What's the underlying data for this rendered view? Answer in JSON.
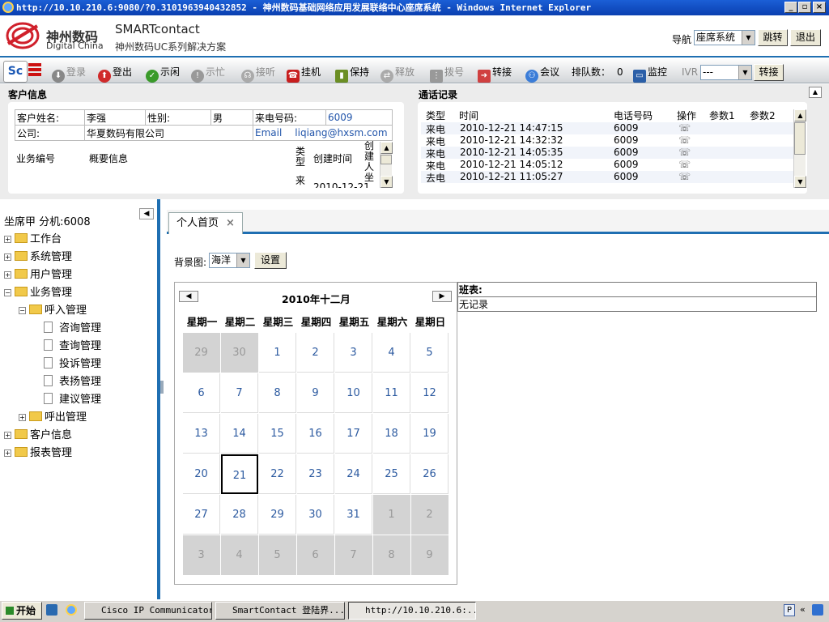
{
  "window": {
    "title": "http://10.10.210.6:9080/?0.3101963940432852 - 神州数码基础网络应用发展联络中心座席系统 - Windows Internet Explorer"
  },
  "header": {
    "logo_cn": "神州数码",
    "logo_en": "Digital China",
    "product": "SMARTcontact",
    "product_sub": "神州数码UC系列解决方案",
    "nav_label": "导航",
    "nav_select": "座席系统",
    "jump_label": "跳转",
    "exit_label": "退出"
  },
  "toolbar": {
    "login": "登录",
    "logout": "登出",
    "idle": "示闲",
    "busy": "示忙",
    "answer": "接听",
    "hangup": "挂机",
    "hold": "保持",
    "release": "释放",
    "dial": "拨号",
    "transfer": "转接",
    "conference": "会议",
    "queue_label": "排队数：",
    "queue_count": "0",
    "monitor": "监控",
    "ivr_label": "IVR",
    "ivr_select": "---",
    "ivr_transfer": "转接"
  },
  "customer": {
    "title": "客户信息",
    "name_label": "客户姓名:",
    "name": "李强",
    "gender_label": "性别:",
    "gender": "男",
    "phone_label": "来电号码:",
    "phone": "6009",
    "company_label": "公司:",
    "company": "华夏数码有限公司",
    "email_label": "Email",
    "email": "liqiang@hxsm.com",
    "biz_no": "业务编号",
    "summary": "概要信息",
    "col_type": "类型",
    "col_created": "创建时间",
    "col_creator": "创建人坐",
    "row_type": "来",
    "row_created": "2010-12-21"
  },
  "calllog": {
    "title": "通话记录",
    "headers": [
      "类型",
      "时间",
      "电话号码",
      "操作",
      "参数1",
      "参数2"
    ],
    "rows": [
      {
        "type": "来电",
        "time": "2010-12-21 14:47:15",
        "phone": "6009"
      },
      {
        "type": "来电",
        "time": "2010-12-21 14:32:32",
        "phone": "6009"
      },
      {
        "type": "来电",
        "time": "2010-12-21 14:05:35",
        "phone": "6009"
      },
      {
        "type": "来电",
        "time": "2010-12-21 14:05:12",
        "phone": "6009"
      },
      {
        "type": "去电",
        "time": "2010-12-21 11:05:27",
        "phone": "6009"
      }
    ]
  },
  "agent": {
    "label": "坐席甲 分机:6008"
  },
  "tree": [
    {
      "label": "工作台",
      "kind": "folder",
      "level": 0,
      "expanded": false
    },
    {
      "label": "系统管理",
      "kind": "folder",
      "level": 0,
      "expanded": false
    },
    {
      "label": "用户管理",
      "kind": "folder",
      "level": 0,
      "expanded": false
    },
    {
      "label": "业务管理",
      "kind": "folder",
      "level": 0,
      "expanded": true
    },
    {
      "label": "呼入管理",
      "kind": "folder",
      "level": 1,
      "expanded": true
    },
    {
      "label": "咨询管理",
      "kind": "doc",
      "level": 2
    },
    {
      "label": "查询管理",
      "kind": "doc",
      "level": 2
    },
    {
      "label": "投诉管理",
      "kind": "doc",
      "level": 2
    },
    {
      "label": "表扬管理",
      "kind": "doc",
      "level": 2
    },
    {
      "label": "建议管理",
      "kind": "doc",
      "level": 2
    },
    {
      "label": "呼出管理",
      "kind": "folder",
      "level": 1,
      "expanded": false
    },
    {
      "label": "客户信息",
      "kind": "folder",
      "level": 0,
      "expanded": false
    },
    {
      "label": "报表管理",
      "kind": "folder",
      "level": 0,
      "expanded": false
    }
  ],
  "tab": {
    "label": "个人首页",
    "close": "×"
  },
  "background": {
    "label": "背景图:",
    "select": "海洋",
    "set_label": "设置"
  },
  "calendar": {
    "title": "2010年十二月",
    "weekdays": [
      "星期一",
      "星期二",
      "星期三",
      "星期四",
      "星期五",
      "星期六",
      "星期日"
    ],
    "weeks": [
      [
        29,
        30,
        1,
        2,
        3,
        4,
        5
      ],
      [
        6,
        7,
        8,
        9,
        10,
        11,
        12
      ],
      [
        13,
        14,
        15,
        16,
        17,
        18,
        19
      ],
      [
        20,
        21,
        22,
        23,
        24,
        25,
        26
      ],
      [
        27,
        28,
        29,
        30,
        31,
        1,
        2
      ],
      [
        3,
        4,
        5,
        6,
        7,
        8,
        9
      ]
    ],
    "other_month_cells": [
      "0-0",
      "0-1",
      "4-5",
      "4-6",
      "5-0",
      "5-1",
      "5-2",
      "5-3",
      "5-4",
      "5-5",
      "5-6"
    ],
    "today": "3-1"
  },
  "schedule": {
    "title": "班表:",
    "empty": "无记录"
  },
  "taskbar": {
    "start": "开始",
    "tasks": [
      "Cisco IP Communicator",
      "SmartContact 登陆界...",
      "http://10.10.210.6:..."
    ]
  },
  "colors": {
    "accent": "#1f6fb2",
    "link": "#2c5aa0",
    "titlebar": "#0a3fb0"
  }
}
